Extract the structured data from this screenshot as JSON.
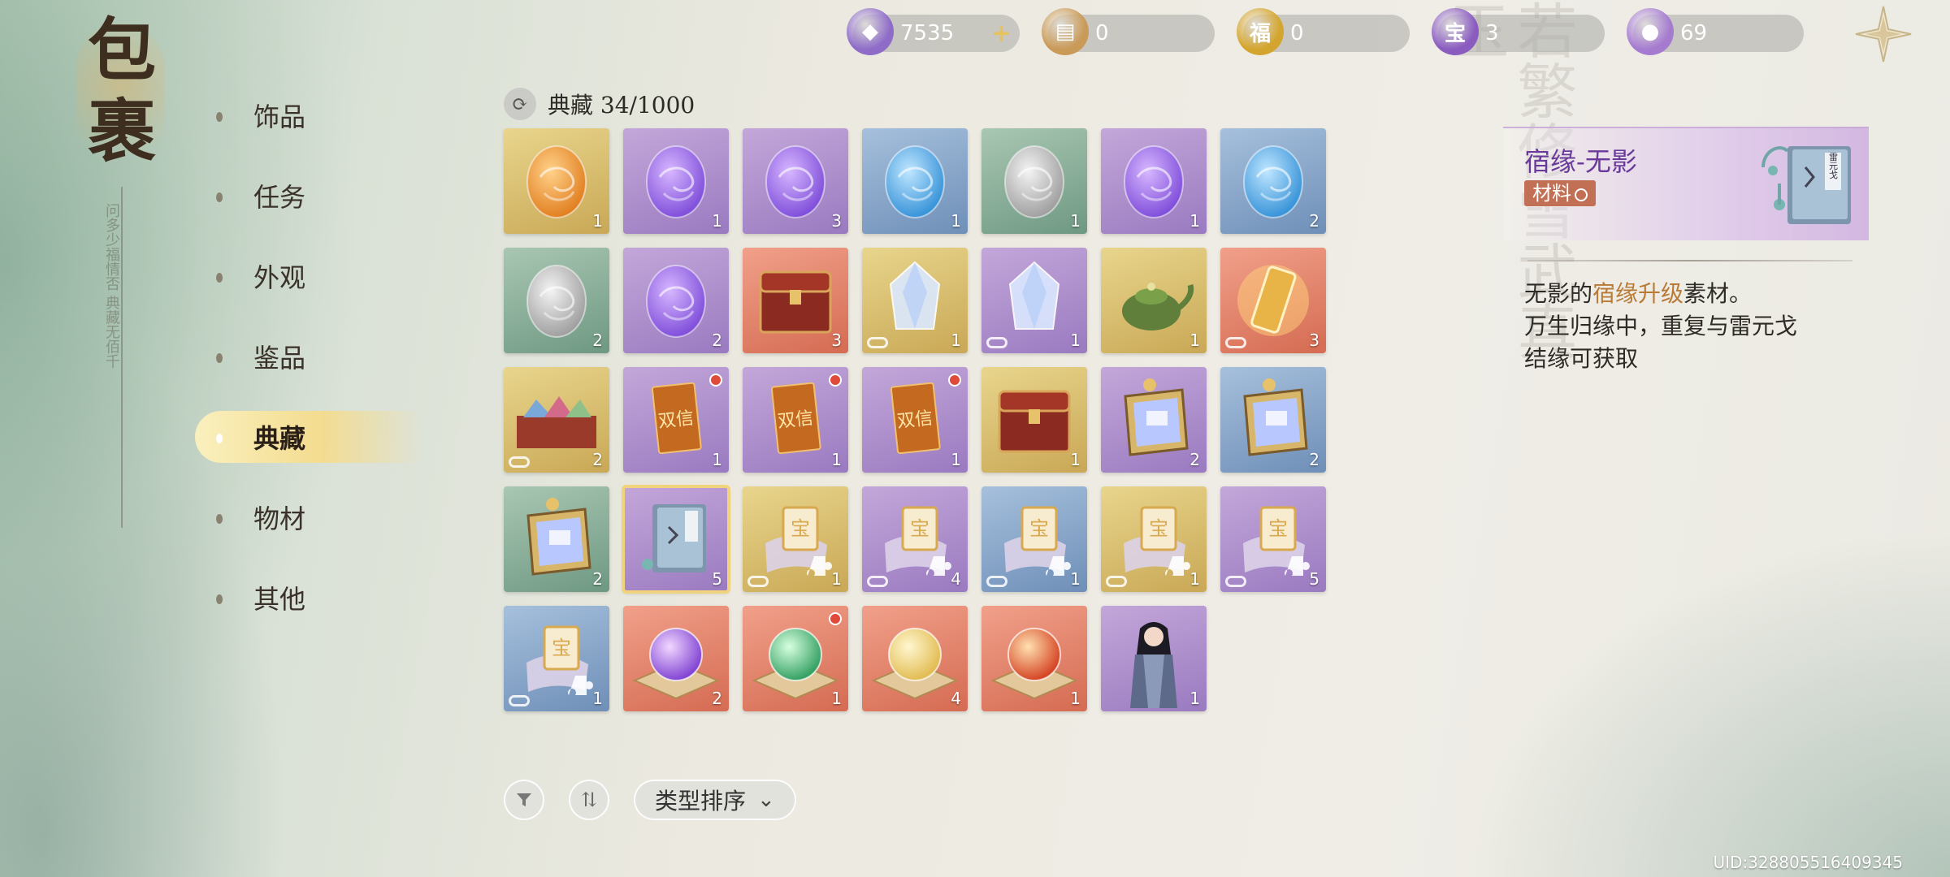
{
  "logo": {
    "char1": "包",
    "char2": "裹",
    "note": "问多少福情否 典藏无佰千"
  },
  "nav": {
    "items": [
      {
        "label": "饰品",
        "active": false
      },
      {
        "label": "任务",
        "active": false
      },
      {
        "label": "外观",
        "active": false
      },
      {
        "label": "鉴品",
        "active": false
      },
      {
        "label": "典藏",
        "active": true
      },
      {
        "label": "物材",
        "active": false
      },
      {
        "label": "其他",
        "active": false
      }
    ]
  },
  "currencies": [
    {
      "value": "7535",
      "icon": "purple-crystal-icon",
      "has_plus": true,
      "color": "#8e6cc8"
    },
    {
      "value": "0",
      "icon": "scroll-ticket-icon",
      "has_plus": false,
      "color": "#c99a58"
    },
    {
      "value": "0",
      "icon": "gold-coin-icon",
      "has_plus": false,
      "color": "#d4a52e"
    },
    {
      "value": "3",
      "icon": "treasure-coin-icon",
      "has_plus": false,
      "color": "#8a5cc0"
    },
    {
      "value": "69",
      "icon": "jade-pearl-icon",
      "has_plus": false,
      "color": "#a57bd0"
    }
  ],
  "collection": {
    "title": "典藏 34/1000"
  },
  "grid_items": [
    {
      "row": 0,
      "col": 0,
      "rarity": "gold",
      "art": "egg-orange",
      "count": "1",
      "link": false,
      "dot": false
    },
    {
      "row": 0,
      "col": 1,
      "rarity": "purple",
      "art": "egg-purple",
      "count": "1",
      "link": false,
      "dot": false
    },
    {
      "row": 0,
      "col": 2,
      "rarity": "purple",
      "art": "egg-purple",
      "count": "3",
      "link": false,
      "dot": false
    },
    {
      "row": 0,
      "col": 3,
      "rarity": "blue",
      "art": "egg-blue",
      "count": "1",
      "link": false,
      "dot": false
    },
    {
      "row": 0,
      "col": 4,
      "rarity": "green",
      "art": "egg-silver",
      "count": "1",
      "link": false,
      "dot": false
    },
    {
      "row": 0,
      "col": 5,
      "rarity": "purple",
      "art": "egg-purple",
      "count": "1",
      "link": false,
      "dot": false
    },
    {
      "row": 0,
      "col": 6,
      "rarity": "blue",
      "art": "egg-blue",
      "count": "2",
      "link": false,
      "dot": false
    },
    {
      "row": 1,
      "col": 0,
      "rarity": "green",
      "art": "egg-silver",
      "count": "2",
      "link": false,
      "dot": false
    },
    {
      "row": 1,
      "col": 1,
      "rarity": "purple",
      "art": "egg-purple",
      "count": "2",
      "link": false,
      "dot": false
    },
    {
      "row": 1,
      "col": 2,
      "rarity": "red",
      "art": "chest",
      "count": "3",
      "link": false,
      "dot": false
    },
    {
      "row": 1,
      "col": 3,
      "rarity": "gold",
      "art": "crystal",
      "count": "1",
      "link": true,
      "dot": false
    },
    {
      "row": 1,
      "col": 4,
      "rarity": "purple",
      "art": "crystal",
      "count": "1",
      "link": true,
      "dot": false
    },
    {
      "row": 1,
      "col": 5,
      "rarity": "gold",
      "art": "teapot",
      "count": "1",
      "link": false,
      "dot": false
    },
    {
      "row": 1,
      "col": 6,
      "rarity": "red",
      "art": "token",
      "count": "3",
      "link": true,
      "dot": false
    },
    {
      "row": 2,
      "col": 0,
      "rarity": "gold",
      "art": "fabric-box",
      "count": "2",
      "link": true,
      "dot": false
    },
    {
      "row": 2,
      "col": 1,
      "rarity": "purple",
      "art": "card-double",
      "count": "1",
      "link": false,
      "dot": true
    },
    {
      "row": 2,
      "col": 2,
      "rarity": "purple",
      "art": "card-double",
      "count": "1",
      "link": false,
      "dot": true
    },
    {
      "row": 2,
      "col": 3,
      "rarity": "purple",
      "art": "card-double",
      "count": "1",
      "link": false,
      "dot": true
    },
    {
      "row": 2,
      "col": 4,
      "rarity": "gold",
      "art": "chest",
      "count": "1",
      "link": false,
      "dot": false
    },
    {
      "row": 2,
      "col": 5,
      "rarity": "purple",
      "art": "gift-frame",
      "count": "2",
      "link": false,
      "dot": false
    },
    {
      "row": 2,
      "col": 6,
      "rarity": "blue",
      "art": "gift-frame",
      "count": "2",
      "link": false,
      "dot": false
    },
    {
      "row": 3,
      "col": 0,
      "rarity": "green",
      "art": "gift-frame",
      "count": "2",
      "link": false,
      "dot": false
    },
    {
      "row": 3,
      "col": 1,
      "rarity": "purple",
      "art": "book",
      "count": "5",
      "link": false,
      "dot": false,
      "selected": true
    },
    {
      "row": 3,
      "col": 2,
      "rarity": "gold",
      "art": "treasure-puzzle",
      "count": "1",
      "link": true,
      "dot": false
    },
    {
      "row": 3,
      "col": 3,
      "rarity": "purple",
      "art": "treasure-puzzle",
      "count": "4",
      "link": true,
      "dot": false
    },
    {
      "row": 3,
      "col": 4,
      "rarity": "blue",
      "art": "treasure-puzzle",
      "count": "1",
      "link": true,
      "dot": false
    },
    {
      "row": 3,
      "col": 5,
      "rarity": "gold",
      "art": "treasure-puzzle",
      "count": "1",
      "link": true,
      "dot": false
    },
    {
      "row": 3,
      "col": 6,
      "rarity": "purple",
      "art": "treasure-puzzle",
      "count": "5",
      "link": true,
      "dot": false
    },
    {
      "row": 4,
      "col": 0,
      "rarity": "blue",
      "art": "treasure-puzzle",
      "count": "1",
      "link": true,
      "dot": false
    },
    {
      "row": 4,
      "col": 1,
      "rarity": "red",
      "art": "orb-purple",
      "count": "2",
      "link": false,
      "dot": false
    },
    {
      "row": 4,
      "col": 2,
      "rarity": "red",
      "art": "orb-green",
      "count": "1",
      "link": false,
      "dot": true
    },
    {
      "row": 4,
      "col": 3,
      "rarity": "red",
      "art": "orb-yellow",
      "count": "4",
      "link": false,
      "dot": false
    },
    {
      "row": 4,
      "col": 4,
      "rarity": "red",
      "art": "orb-red",
      "count": "1",
      "link": false,
      "dot": false
    },
    {
      "row": 4,
      "col": 5,
      "rarity": "purple",
      "art": "character",
      "count": "1",
      "link": false,
      "dot": false
    }
  ],
  "card_double_text": "双信",
  "bottom": {
    "sort_label": "类型排序"
  },
  "detail": {
    "name": "宿缘-无影",
    "tag": "材料",
    "book_title": "雷元戈",
    "desc_line1_pre": "无影的",
    "desc_line1_hl": "宿缘升级",
    "desc_line1_post": "素材。",
    "desc_line2": "万生归缘中，重复与雷元戈",
    "desc_line3": "结缘可获取"
  },
  "uid": "UID:32880551640​9345",
  "bg_text": "若繁修雪武真玉"
}
